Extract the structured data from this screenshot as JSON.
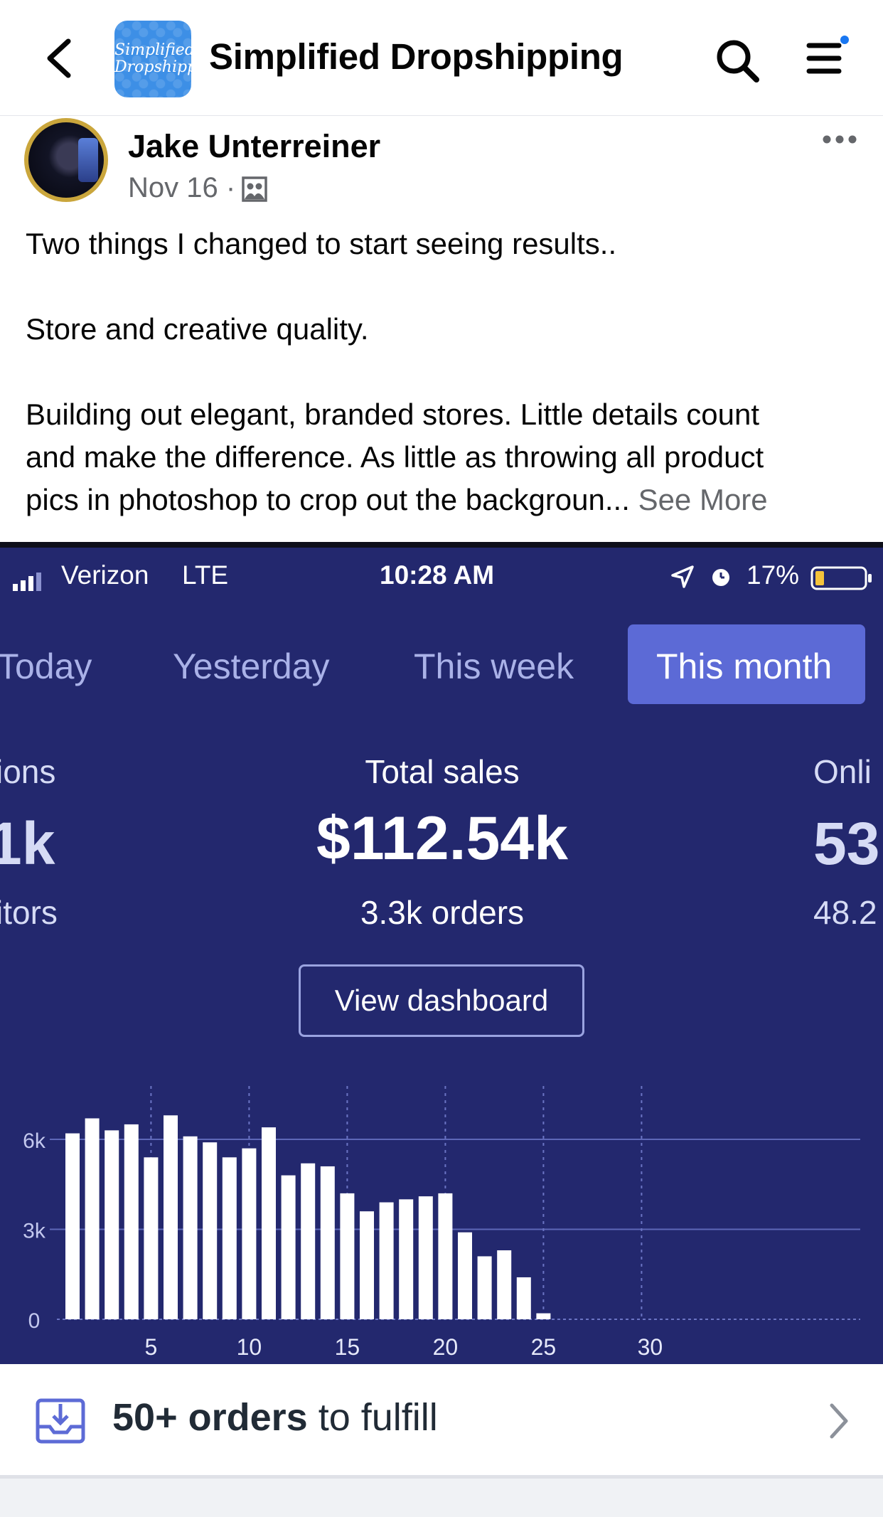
{
  "header": {
    "back_icon": "chevron-left-icon",
    "group_logo_text": [
      "Simplified",
      "Dropshippin"
    ],
    "group_name": "Simplified Dropshipping",
    "search_icon": "search-icon",
    "menu_icon": "menu-icon",
    "notification_dot_color": "#1877f2"
  },
  "post": {
    "author": "Jake Unterreiner",
    "date": "Nov 16 ·",
    "privacy_icon": "group-members-icon",
    "more_icon": "more-dots-icon",
    "text_lines": [
      "Two things I changed to start seeing results..",
      "Store and creative quality.",
      "Building out elegant, branded stores. Little details count",
      "and make the difference. As little as throwing all product",
      "pics in photoshop to crop out the backgroun..."
    ],
    "see_more": "See More"
  },
  "screenshot": {
    "status_bar": {
      "carrier": "Verizon",
      "network": "LTE",
      "time": "10:28 AM",
      "battery": "17%"
    },
    "tabs": [
      "Today",
      "Yesterday",
      "This week",
      "This month"
    ],
    "active_tab": "This month",
    "left_stat": {
      "label": "ions",
      "value": "1k",
      "sub": "itors"
    },
    "center_stat": {
      "label": "Total sales",
      "value": "$112.54k",
      "sub": "3.3k orders"
    },
    "right_stat": {
      "label": "Onli",
      "value": "53",
      "sub": "48.2"
    },
    "view_dashboard": "View dashboard",
    "fulfill": {
      "count": "50+ orders",
      "text": "to fulfill",
      "icon": "inbox-download-icon",
      "chevron": "chevron-right-icon"
    },
    "colors": {
      "background": "#23286e",
      "active_tab": "#5c6ad6",
      "bars": "#ffffff"
    }
  },
  "chart_data": {
    "type": "bar",
    "categories": [
      1,
      2,
      3,
      4,
      5,
      6,
      7,
      8,
      9,
      10,
      11,
      12,
      13,
      14,
      15,
      16,
      17,
      18,
      19,
      20,
      21,
      22,
      23,
      24,
      25,
      26,
      27,
      28,
      29,
      30
    ],
    "values": [
      6.2,
      6.7,
      6.3,
      6.5,
      5.4,
      6.8,
      6.1,
      5.9,
      5.4,
      5.7,
      6.4,
      4.8,
      5.2,
      5.1,
      4.2,
      3.6,
      3.9,
      4.0,
      4.1,
      4.2,
      2.9,
      2.1,
      2.3,
      1.4,
      0.2,
      0,
      0,
      0,
      0,
      0
    ],
    "y_ticks": [
      "0",
      "3k",
      "6k"
    ],
    "x_ticks": [
      "5",
      "10",
      "15",
      "20",
      "25",
      "30"
    ],
    "ylim": [
      0,
      7
    ],
    "grid": true,
    "title": "",
    "xlabel": "",
    "ylabel": ""
  }
}
